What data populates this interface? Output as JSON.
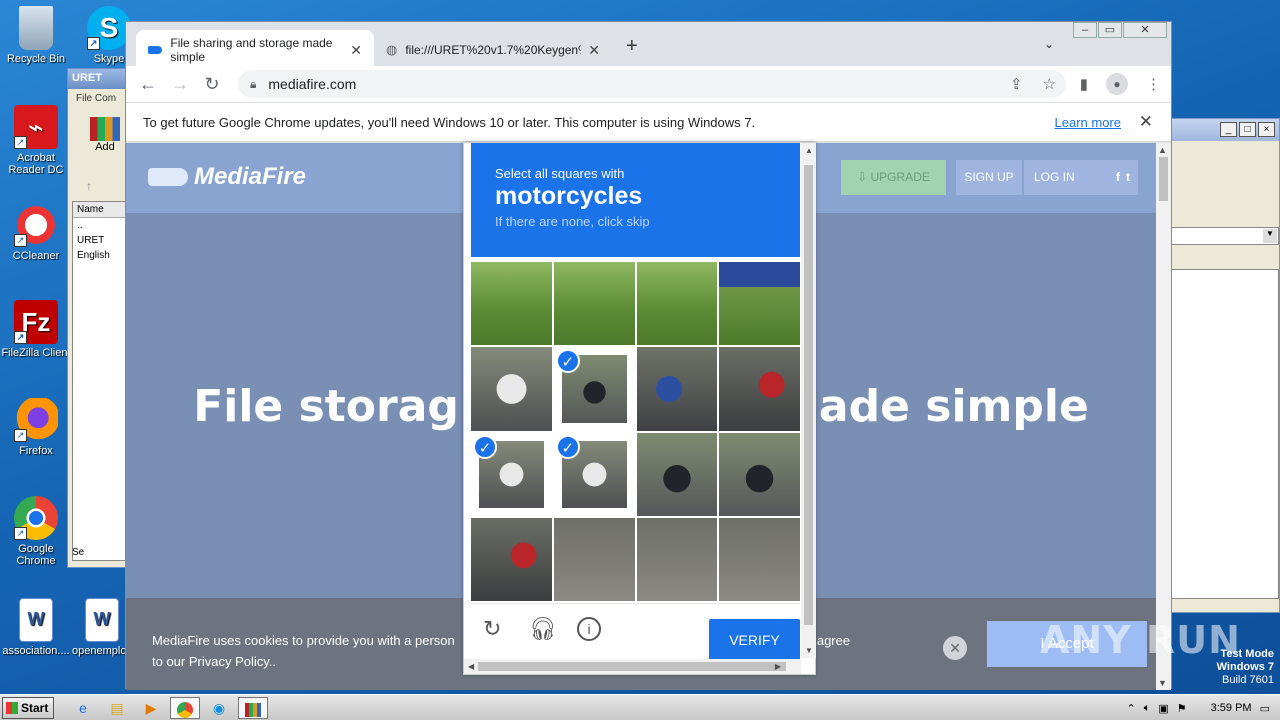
{
  "desktop": {
    "icons": [
      {
        "label": "Recycle Bin",
        "icon": "recycle-bin-icon"
      },
      {
        "label": "Skype",
        "icon": "skype-icon"
      },
      {
        "label": "Acrobat Reader DC",
        "icon": "acrobat-icon"
      },
      {
        "label": "CCleaner",
        "icon": "ccleaner-icon"
      },
      {
        "label": "FileZilla Client",
        "icon": "filezilla-icon"
      },
      {
        "label": "Firefox",
        "icon": "firefox-icon"
      },
      {
        "label": "Google Chrome",
        "icon": "chrome-icon"
      },
      {
        "label": "association....",
        "icon": "word-doc-icon"
      },
      {
        "label": "openemploy",
        "icon": "word-doc-icon"
      }
    ]
  },
  "winrar": {
    "title": "URET",
    "menu": [
      "File",
      "Com"
    ],
    "add_label": "Add",
    "col_name": "Name",
    "rows": [
      "..",
      "URET",
      "English"
    ],
    "status": "Se"
  },
  "chrome": {
    "tabs": [
      {
        "title": "File sharing and storage made simple",
        "icon": "mediafire-icon"
      },
      {
        "title": "file:///URET%20v1.7%20Keygen%",
        "icon": "globe-icon"
      }
    ],
    "url": "mediafire.com",
    "infobar": {
      "text": "To get future Google Chrome updates, you'll need Windows 10 or later. This computer is using Windows 7.",
      "link": "Learn more"
    }
  },
  "mediafire": {
    "logo": "MediaFire",
    "upgrade": "UPGRADE",
    "signup": "SIGN UP",
    "login": "LOG IN",
    "social": [
      "f",
      "t"
    ],
    "hero_left": "File storag",
    "hero_right": "ade simple",
    "cookie_text_1": "MediaFire uses cookies to provide you with a person",
    "cookie_text_1b": "ou agree",
    "cookie_text_2": "to our Privacy Policy..",
    "accept": "I Accept"
  },
  "captcha": {
    "prompt": "Select all squares with",
    "target": "motorcycles",
    "hint": "If there are none, click skip",
    "verify": "VERIFY",
    "tiles": [
      {
        "kind": "grass",
        "selected": false
      },
      {
        "kind": "grass",
        "selected": false
      },
      {
        "kind": "grass",
        "selected": false
      },
      {
        "kind": "sign",
        "selected": false
      },
      {
        "kind": "bikew",
        "selected": false
      },
      {
        "kind": "bike",
        "selected": true
      },
      {
        "kind": "bikeb",
        "selected": false
      },
      {
        "kind": "bikerd",
        "selected": false
      },
      {
        "kind": "bikew",
        "selected": true
      },
      {
        "kind": "bikew",
        "selected": true
      },
      {
        "kind": "bike",
        "selected": false
      },
      {
        "kind": "bike",
        "selected": false
      },
      {
        "kind": "bikerd",
        "selected": false
      },
      {
        "kind": "road",
        "selected": false
      },
      {
        "kind": "road",
        "selected": false
      },
      {
        "kind": "road",
        "selected": false
      }
    ]
  },
  "watermark": "ANY RUN",
  "testmode": {
    "l1": "Test Mode",
    "l2": "Windows 7",
    "l3": "Build 7601"
  },
  "taskbar": {
    "start": "Start",
    "clock": "3:59 PM"
  }
}
